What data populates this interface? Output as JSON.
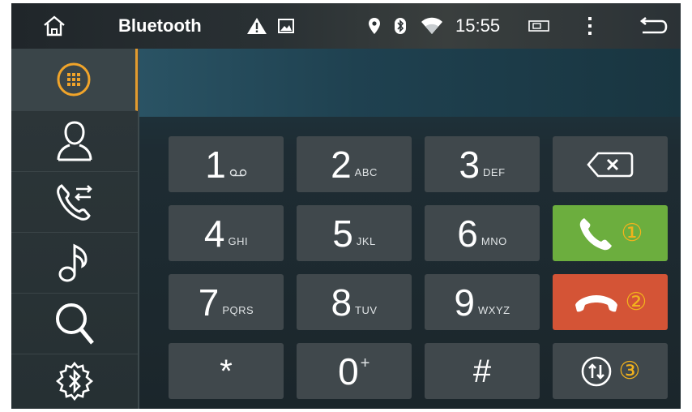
{
  "status_bar": {
    "title": "Bluetooth",
    "time": "15:55",
    "icons": [
      "home-icon",
      "warning-icon",
      "image-icon",
      "location-icon",
      "bluetooth-icon",
      "wifi-icon",
      "battery-icon",
      "more-icon",
      "back-icon"
    ]
  },
  "sidebar": {
    "items": [
      {
        "icon": "dialpad-icon",
        "active": true
      },
      {
        "icon": "contacts-icon",
        "active": false
      },
      {
        "icon": "call-log-icon",
        "active": false
      },
      {
        "icon": "music-icon",
        "active": false
      },
      {
        "icon": "search-icon",
        "active": false
      },
      {
        "icon": "bluetooth-settings-icon",
        "active": false
      }
    ]
  },
  "dialer": {
    "display_value": "",
    "keys": [
      {
        "digit": "1",
        "letters": "⫐"
      },
      {
        "digit": "2",
        "letters": "ABC"
      },
      {
        "digit": "3",
        "letters": "DEF"
      },
      {
        "digit": "4",
        "letters": "GHI"
      },
      {
        "digit": "5",
        "letters": "JKL"
      },
      {
        "digit": "6",
        "letters": "MNO"
      },
      {
        "digit": "7",
        "letters": "PQRS"
      },
      {
        "digit": "8",
        "letters": "TUV"
      },
      {
        "digit": "9",
        "letters": "WXYZ"
      },
      {
        "digit": "*",
        "letters": ""
      },
      {
        "digit": "0",
        "letters": "+"
      },
      {
        "digit": "#",
        "letters": ""
      }
    ],
    "actions": {
      "call_badge": "①",
      "end_badge": "②",
      "transfer_badge": "③"
    },
    "colors": {
      "call": "#6cae3e",
      "end": "#d45436",
      "badge": "#f2b21c",
      "accent": "#e39b2e"
    }
  }
}
